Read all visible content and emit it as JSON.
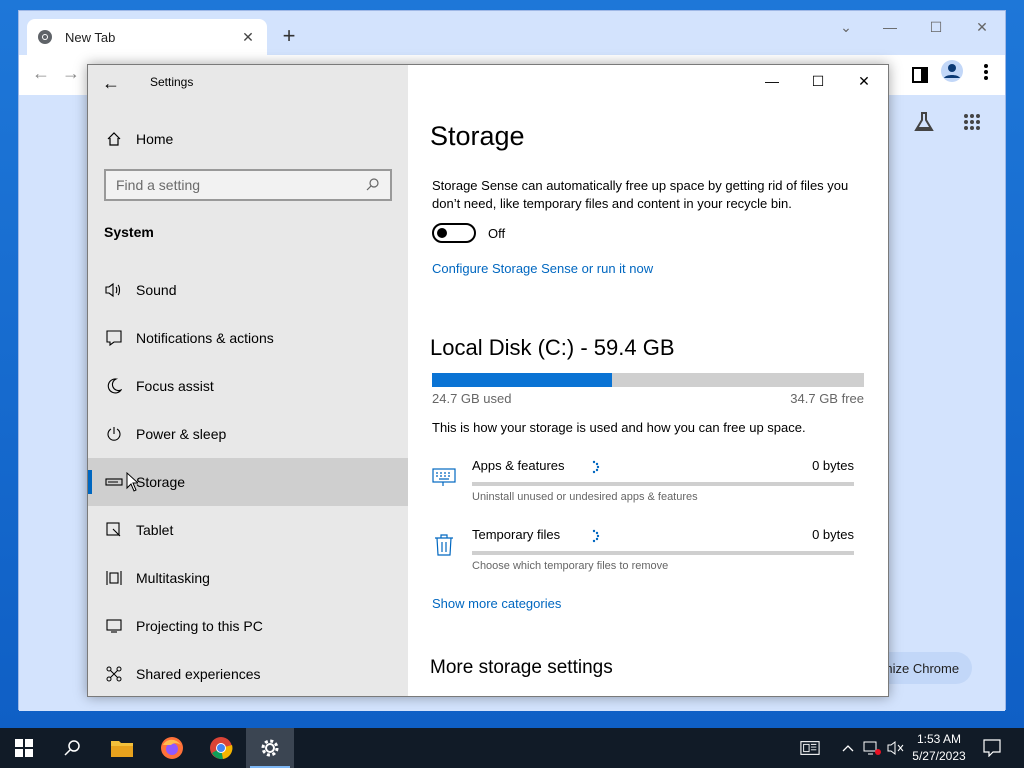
{
  "chrome": {
    "tab_title": "New Tab",
    "new_tab_symbol": "+",
    "customize_label": "tomize Chrome"
  },
  "settings": {
    "window_title": "Settings",
    "home_label": "Home",
    "search_placeholder": "Find a setting",
    "section_label": "System",
    "nav_items": [
      {
        "label": "Sound",
        "icon": "speaker-icon"
      },
      {
        "label": "Notifications & actions",
        "icon": "notification-icon"
      },
      {
        "label": "Focus assist",
        "icon": "moon-icon"
      },
      {
        "label": "Power & sleep",
        "icon": "power-icon"
      },
      {
        "label": "Storage",
        "icon": "storage-icon",
        "active": true
      },
      {
        "label": "Tablet",
        "icon": "tablet-icon"
      },
      {
        "label": "Multitasking",
        "icon": "multitasking-icon"
      },
      {
        "label": "Projecting to this PC",
        "icon": "projecting-icon"
      },
      {
        "label": "Shared experiences",
        "icon": "shared-icon"
      }
    ],
    "main": {
      "title": "Storage",
      "description": "Storage Sense can automatically free up space by getting rid of files you don’t need, like temporary files and content in your recycle bin.",
      "toggle_state": "Off",
      "configure_link": "Configure Storage Sense or run it now",
      "disk_title": "Local Disk (C:) - 59.4 GB",
      "disk_used_fraction": 0.416,
      "disk_used_label": "24.7 GB used",
      "disk_free_label": "34.7 GB free",
      "disk_desc": "This is how your storage is used and how you can free up space.",
      "categories": [
        {
          "name": "Apps & features",
          "size": "0 bytes",
          "sub": "Uninstall unused or undesired apps & features",
          "icon": "keyboard-icon"
        },
        {
          "name": "Temporary files",
          "size": "0 bytes",
          "sub": "Choose which temporary files to remove",
          "icon": "trash-icon"
        }
      ],
      "show_more_link": "Show more categories",
      "more_title": "More storage settings"
    }
  },
  "taskbar": {
    "time": "1:53 AM",
    "date": "5/27/2023"
  },
  "colors": {
    "accent": "#0067c0",
    "disk_fill": "#0a73d4",
    "taskbar": "#111b27"
  }
}
